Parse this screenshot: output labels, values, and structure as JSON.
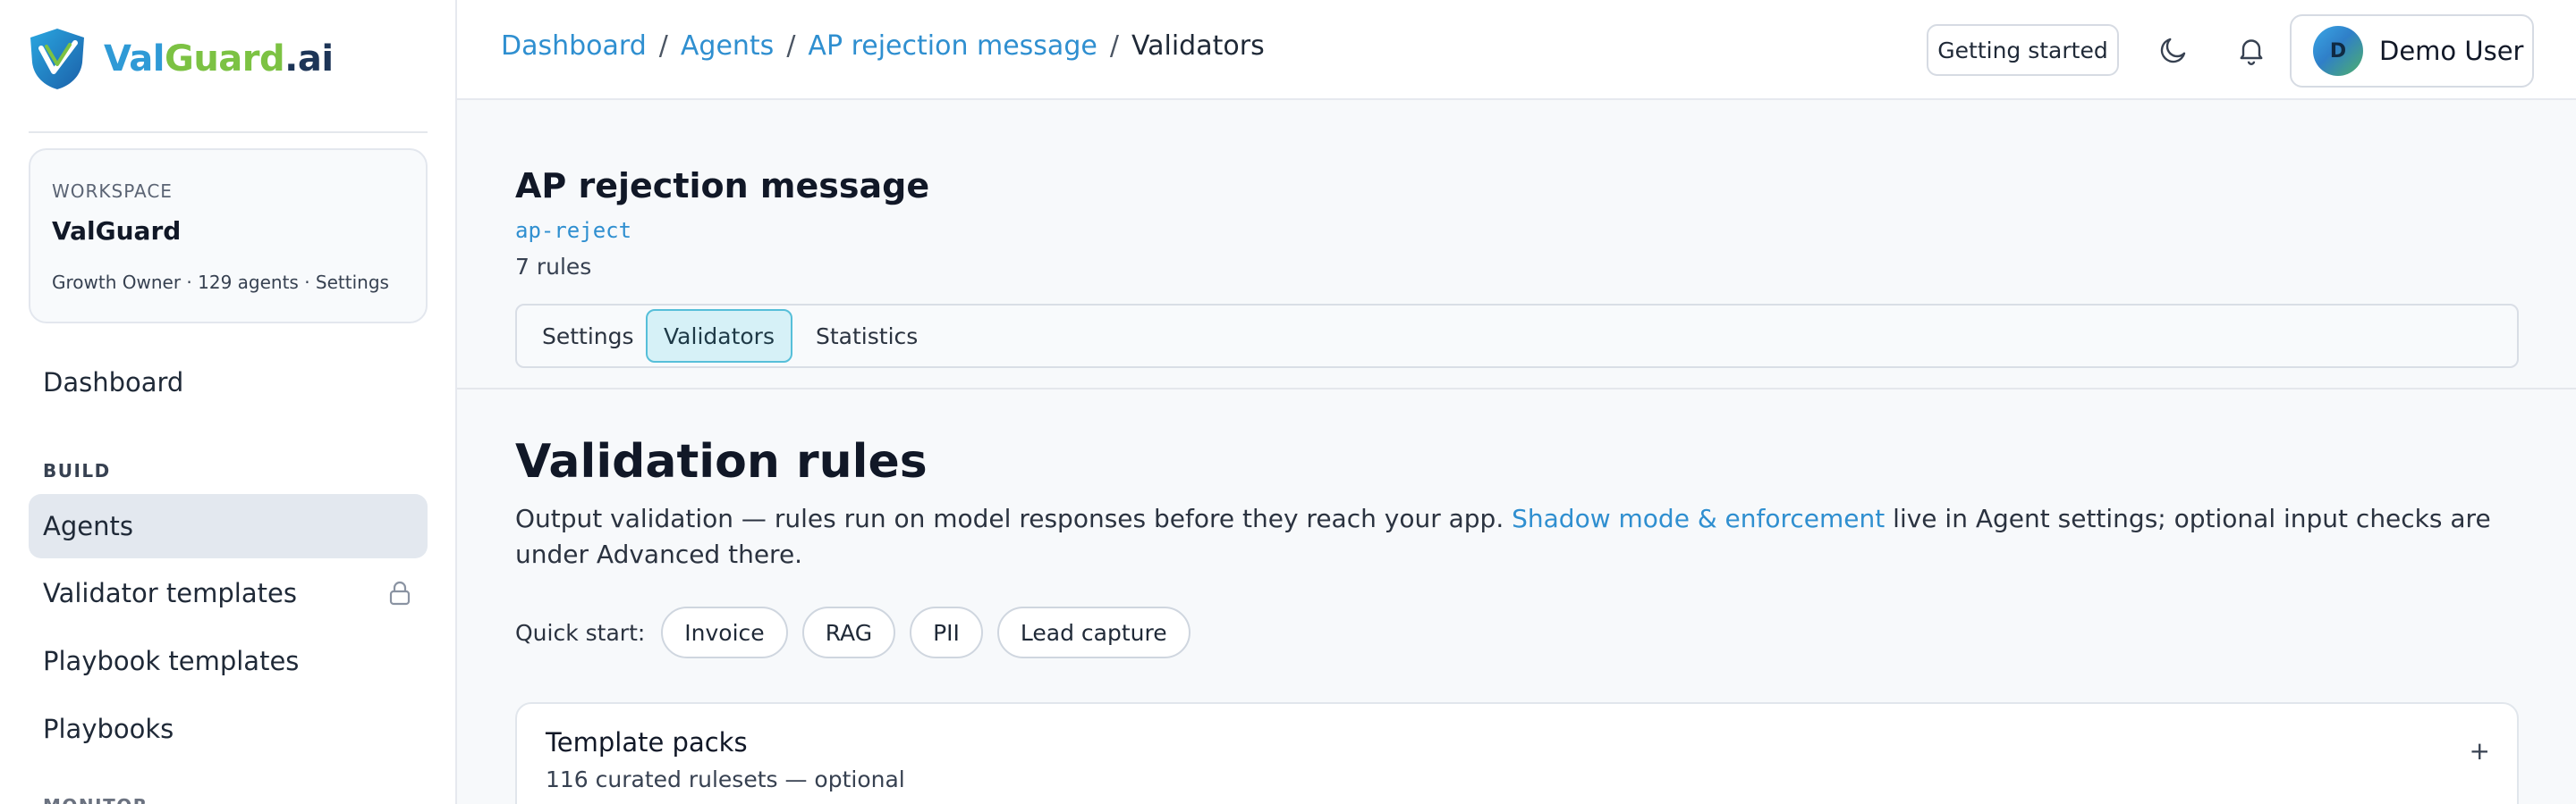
{
  "brand": {
    "part1": "Val",
    "part2": "Guard",
    "part3": ".ai"
  },
  "workspace": {
    "label": "WORKSPACE",
    "name": "ValGuard",
    "meta": "Growth Owner · 129 agents · Settings"
  },
  "nav": {
    "dashboard": "Dashboard",
    "build_section": "BUILD",
    "items": [
      {
        "label": "Agents"
      },
      {
        "label": "Validator templates"
      },
      {
        "label": "Playbook templates"
      },
      {
        "label": "Playbooks"
      }
    ],
    "next_section": "MONITOR"
  },
  "breadcrumbs": [
    "Dashboard",
    "Agents",
    "AP rejection message",
    "Validators"
  ],
  "header": {
    "getting_started": "Getting started",
    "user_initial": "D",
    "user_name": "Demo User"
  },
  "agent": {
    "title": "AP rejection message",
    "slug": "ap-reject",
    "rules": "7 rules"
  },
  "tabs": [
    {
      "label": "Settings"
    },
    {
      "label": "Validators"
    },
    {
      "label": "Statistics"
    }
  ],
  "main": {
    "title": "Validation rules",
    "desc_before": "Output validation — rules run on model responses before they reach your app. ",
    "desc_link": "Shadow mode & enforcement",
    "desc_after": " live in Agent settings; optional input checks are under Advanced there.",
    "quick_label": "Quick start:",
    "quick_chips": [
      "Invoice",
      "RAG",
      "PII",
      "Lead capture"
    ],
    "pack_title": "Template packs",
    "pack_sub": "116 curated rulesets — optional",
    "pack_toggle": "+"
  },
  "colors": {
    "accent": "#2f8fd0",
    "active_tab_bg": "#d6f1f7",
    "active_tab_border": "#56bfd9",
    "active_nav_bg": "#e3e8ef"
  },
  "icons": [
    "valguard-logo-icon",
    "lock-icon",
    "moon-icon",
    "bell-icon"
  ]
}
